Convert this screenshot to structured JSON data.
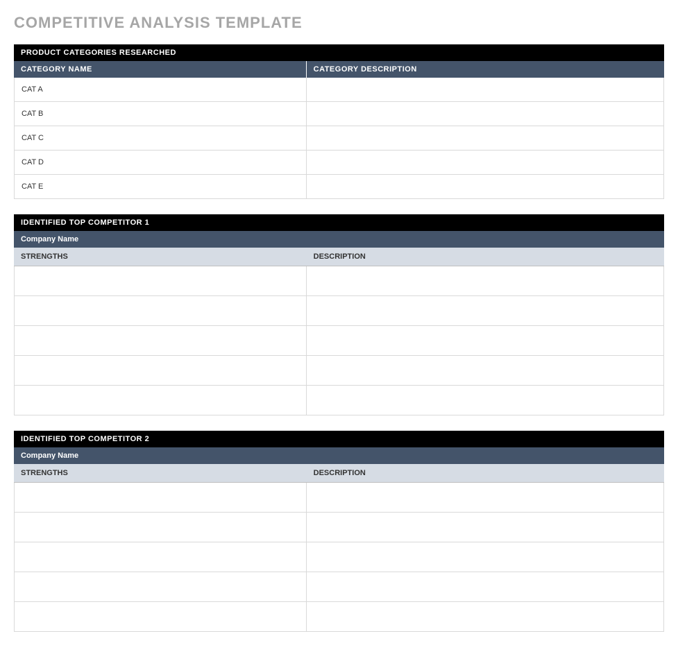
{
  "page_title": "COMPETITIVE ANALYSIS TEMPLATE",
  "categories_section": {
    "header": "PRODUCT CATEGORIES RESEARCHED",
    "col1": "CATEGORY NAME",
    "col2": "CATEGORY DESCRIPTION",
    "rows": [
      {
        "name": "CAT A",
        "desc": ""
      },
      {
        "name": "CAT B",
        "desc": ""
      },
      {
        "name": "CAT C",
        "desc": ""
      },
      {
        "name": "CAT D",
        "desc": ""
      },
      {
        "name": "CAT E",
        "desc": ""
      }
    ]
  },
  "competitor1": {
    "header": "IDENTIFIED TOP COMPETITOR 1",
    "company_label": "Company Name",
    "col1": "STRENGTHS",
    "col2": "DESCRIPTION",
    "rows": [
      {
        "strength": "",
        "desc": ""
      },
      {
        "strength": "",
        "desc": ""
      },
      {
        "strength": "",
        "desc": ""
      },
      {
        "strength": "",
        "desc": ""
      },
      {
        "strength": "",
        "desc": ""
      }
    ]
  },
  "competitor2": {
    "header": "IDENTIFIED TOP COMPETITOR 2",
    "company_label": "Company Name",
    "col1": "STRENGTHS",
    "col2": "DESCRIPTION",
    "rows": [
      {
        "strength": "",
        "desc": ""
      },
      {
        "strength": "",
        "desc": ""
      },
      {
        "strength": "",
        "desc": ""
      },
      {
        "strength": "",
        "desc": ""
      },
      {
        "strength": "",
        "desc": ""
      }
    ]
  }
}
